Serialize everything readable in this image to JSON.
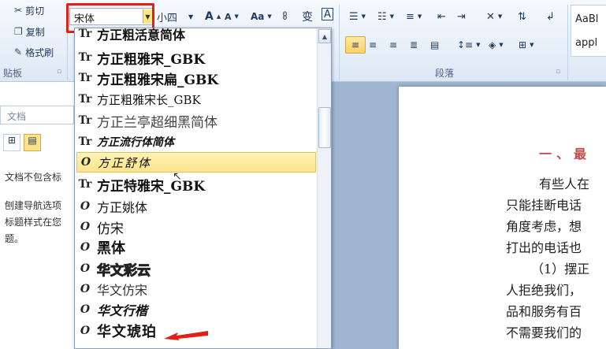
{
  "clipboard": {
    "cut_label": "剪切",
    "copy_label": "复制",
    "format_painter_label": "格式刷",
    "group_label": "贴板",
    "launcher": "▫"
  },
  "font": {
    "current_font": "宋体",
    "current_size": "小四",
    "grow": "A",
    "shrink": "A",
    "case": "Aa",
    "clear": "ꗚ",
    "phonetic": "变",
    "border": "A"
  },
  "paragraph": {
    "group_label": "段落",
    "launcher": "▫"
  },
  "styles": {
    "preview_1": "AaBl",
    "preview_2": "appl"
  },
  "nav": {
    "search_text": "文档",
    "line1": "文档不包含标",
    "line2": "刨建导航选项",
    "line3": "标题样式在您",
    "line4": "题。"
  },
  "font_list": [
    {
      "icon": "Tr",
      "name": "方正粗活意简体"
    },
    {
      "icon": "Tr",
      "name": "方正粗雅宋_GBK"
    },
    {
      "icon": "Tr",
      "name": "方正粗雅宋扁_GBK"
    },
    {
      "icon": "Tr",
      "name": "方正粗雅宋长_GBK"
    },
    {
      "icon": "Tr",
      "name": "方正兰亭超细黑简体"
    },
    {
      "icon": "Tr",
      "name": "方正流行体简体"
    },
    {
      "icon": "O",
      "name": "方正舒体",
      "selected": true
    },
    {
      "icon": "Tr",
      "name": "方正特雅宋_GBK"
    },
    {
      "icon": "O",
      "name": "方正姚体"
    },
    {
      "icon": "O",
      "name": "仿宋"
    },
    {
      "icon": "O",
      "name": "黑体"
    },
    {
      "icon": "O",
      "name": "华文彩云"
    },
    {
      "icon": "O",
      "name": "华文仿宋"
    },
    {
      "icon": "O",
      "name": "华文行楷"
    },
    {
      "icon": "O",
      "name": "华文琥珀"
    }
  ],
  "document": {
    "heading": "一、最",
    "lines": [
      "有些人在",
      "只能挂断电话",
      "角度考虑，想",
      "打出的电话也",
      "（1）摆正",
      "人拒绝我们，",
      "品和服务有百",
      "不需要我们的"
    ]
  },
  "colors": {
    "highlight": "#e22018",
    "ribbon": "#dde8f5",
    "heading": "#c0504d"
  }
}
